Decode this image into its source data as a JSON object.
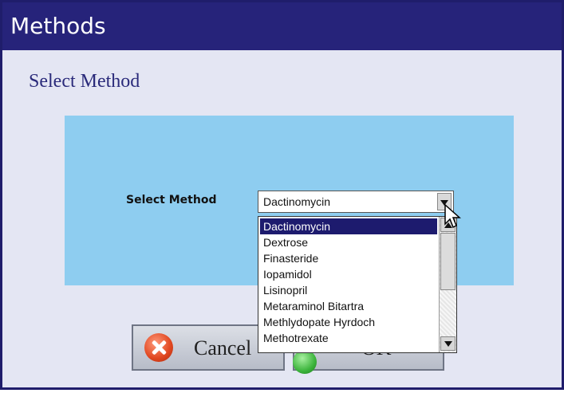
{
  "window": {
    "title": "Methods"
  },
  "heading": "Select Method",
  "field": {
    "label": "Select Method",
    "selected_value": "Dactinomycin"
  },
  "dropdown": {
    "options": [
      "Dactinomycin",
      "Dextrose",
      "Finasteride",
      "Iopamidol",
      "Lisinopril",
      "Metaraminol Bitartra",
      "Methlydopate Hyrdoch",
      "Methotrexate"
    ],
    "highlighted_index": 0
  },
  "buttons": {
    "cancel_label": "Cancel",
    "ok_label": "OK"
  },
  "icons": {
    "cancel": "cancel-x-icon",
    "ok": "ok-check-icon"
  },
  "colors": {
    "titlebar": "#26237a",
    "panel": "#8ecdf0",
    "selection": "#1d1b6e"
  }
}
